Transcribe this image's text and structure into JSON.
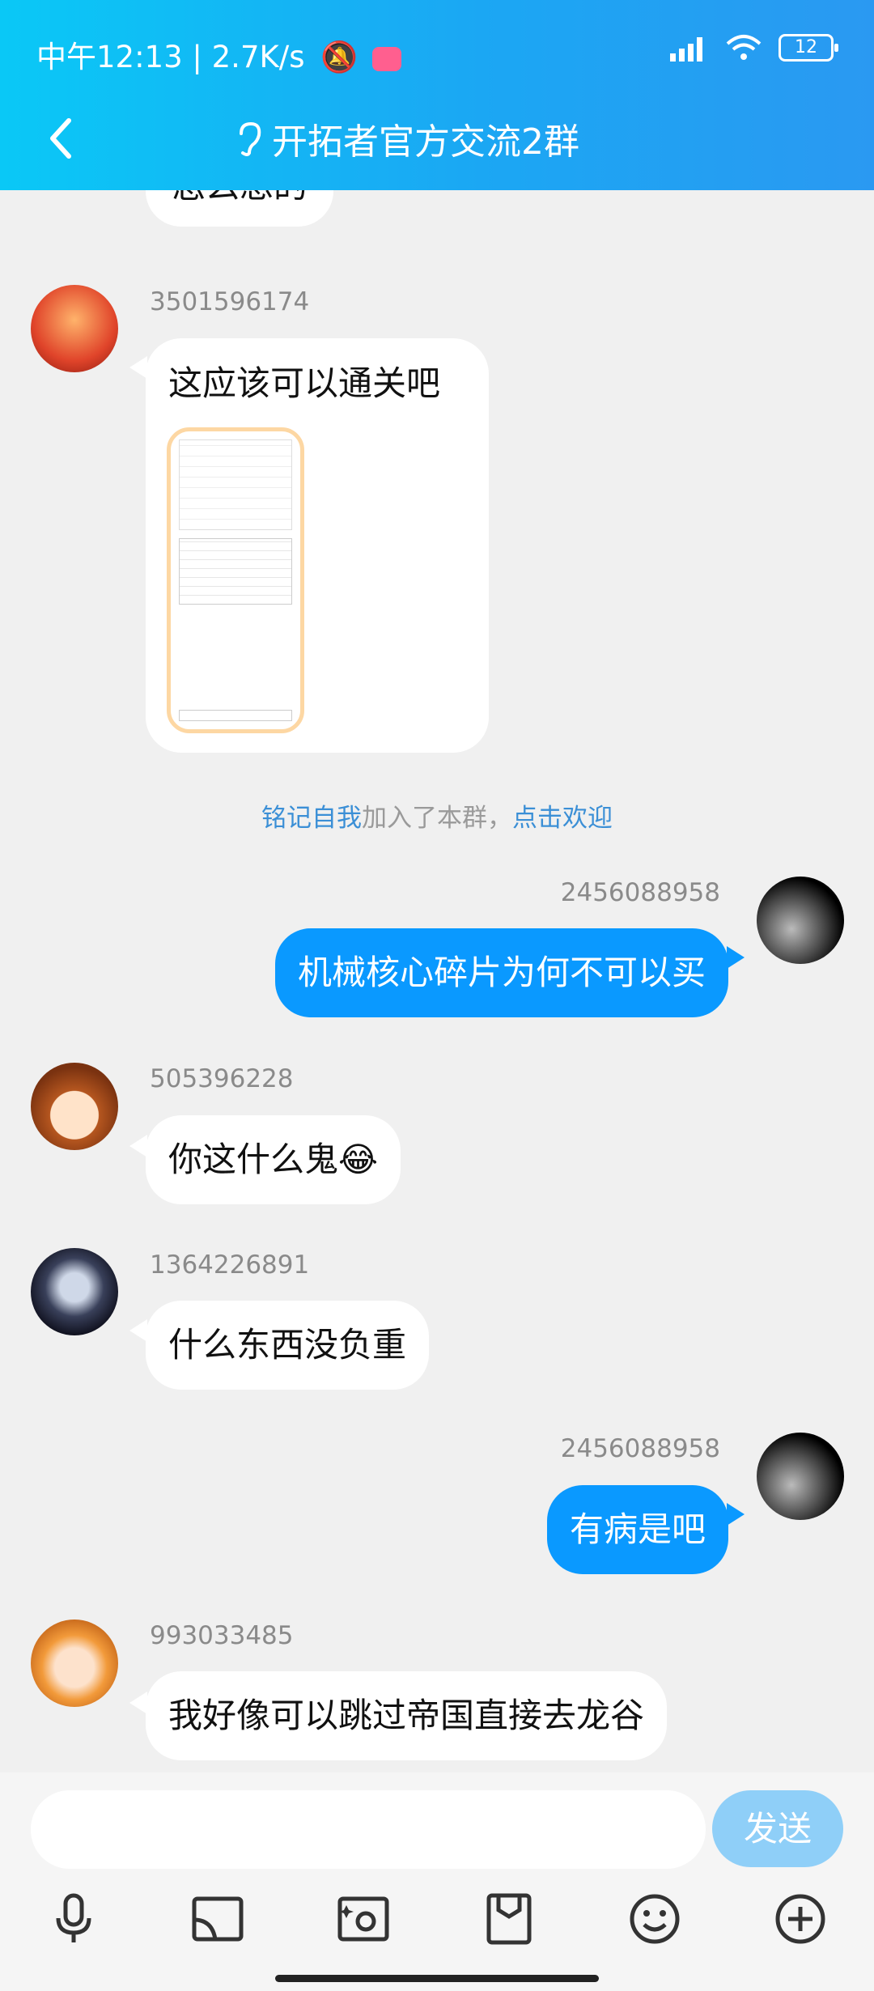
{
  "status_bar": {
    "time": "中午12:13",
    "speed": "2.7K/s",
    "battery": "12"
  },
  "header": {
    "title": "开拓者官方交流2群"
  },
  "messages": [
    {
      "text": "怎么想的"
    },
    {
      "sender": "3501596174",
      "text": "这应该可以通关吧"
    },
    {
      "sender": "2456088958",
      "text": "机械核心碎片为何不可以买"
    },
    {
      "sender": "505396228",
      "text": "你这什么鬼😂"
    },
    {
      "sender": "1364226891",
      "text": "什么东西没负重"
    },
    {
      "sender": "2456088958",
      "text": "有病是吧"
    },
    {
      "sender": "993033485",
      "text": "我好像可以跳过帝国直接去龙谷"
    }
  ],
  "system_message": {
    "name": "铭记自我",
    "middle": "加入了本群，",
    "action": "点击欢迎"
  },
  "input": {
    "placeholder": "",
    "send_label": "发送"
  },
  "toolbar": [
    "microphone-icon",
    "cast-icon",
    "photo-icon",
    "file-icon",
    "emoji-icon",
    "plus-icon"
  ]
}
